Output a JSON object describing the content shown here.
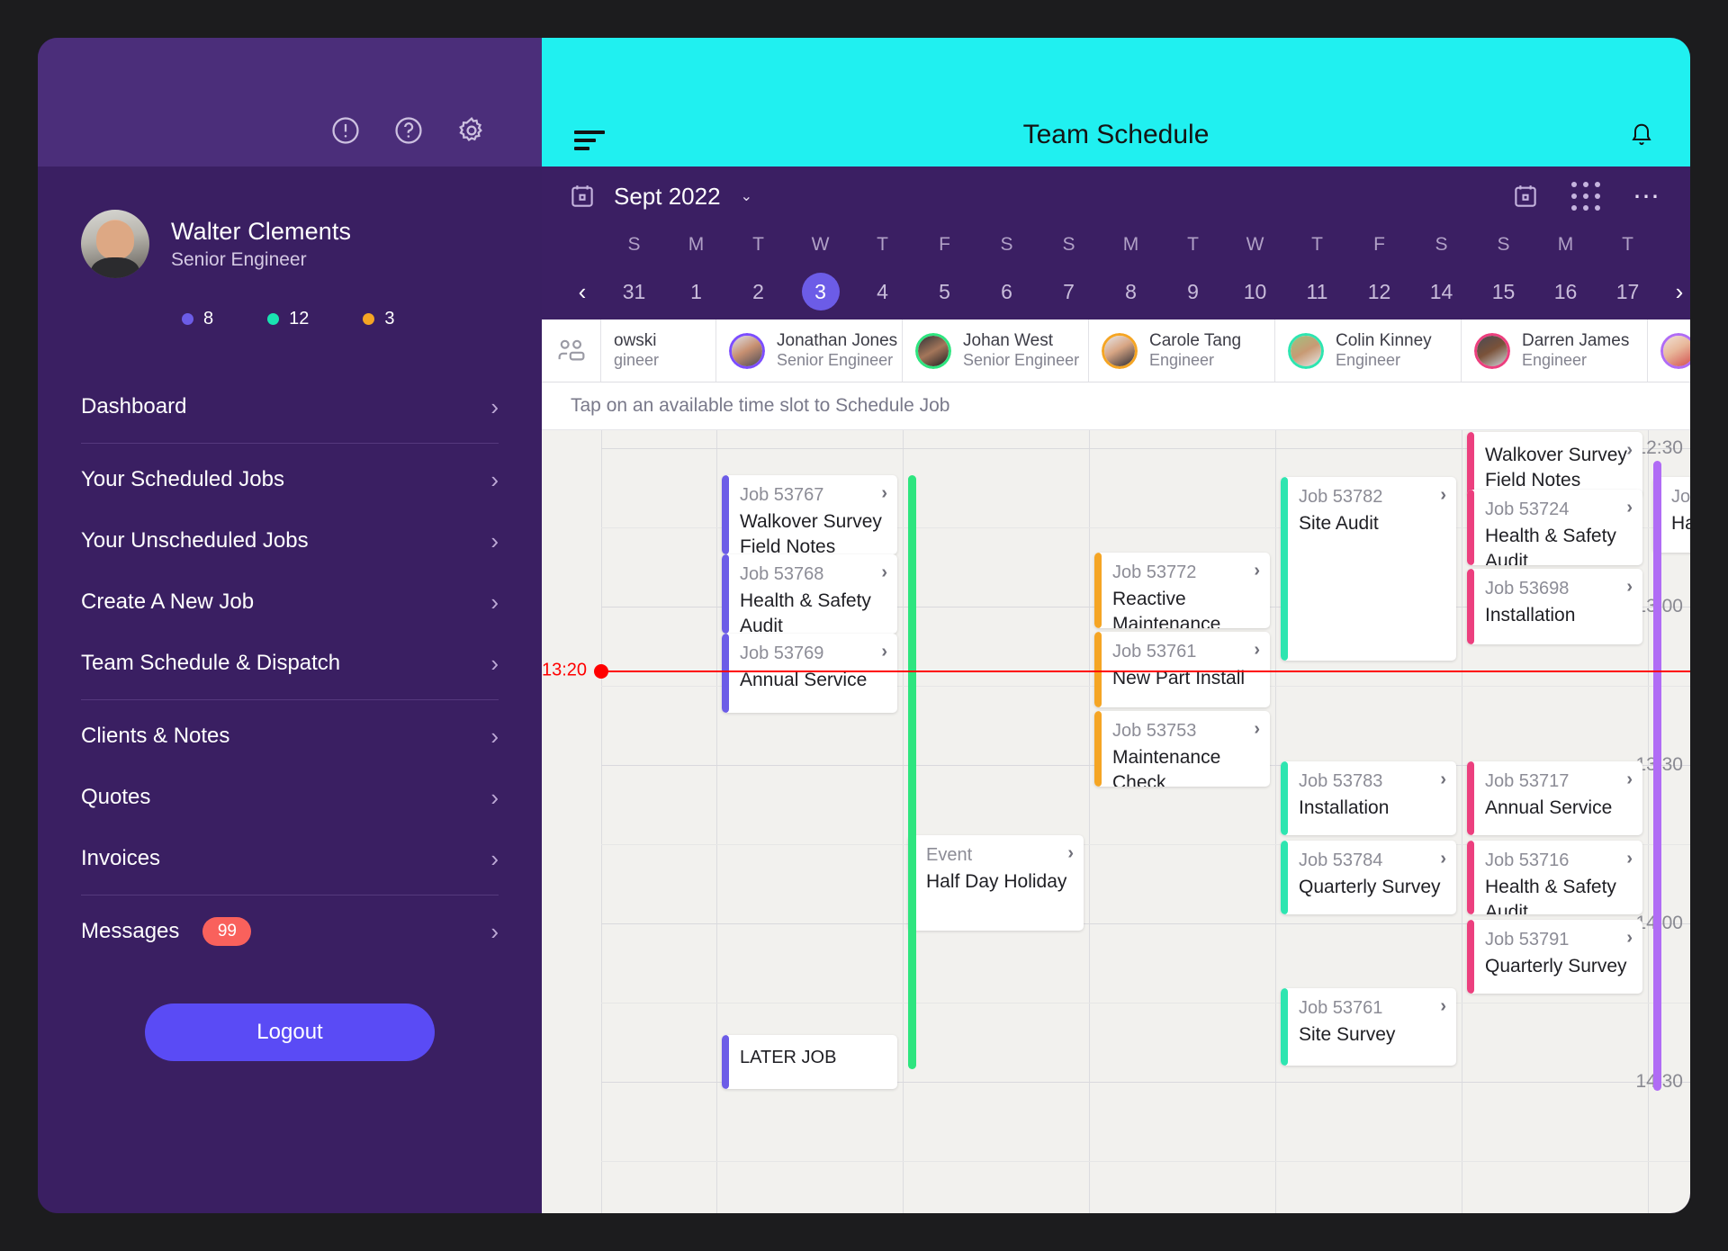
{
  "sidebar": {
    "top_icons": [
      {
        "name": "alert-icon",
        "label": "Alerts"
      },
      {
        "name": "help-icon",
        "label": "Help"
      },
      {
        "name": "gear-icon",
        "label": "Settings"
      }
    ],
    "profile": {
      "name": "Walter Clements",
      "role": "Senior Engineer"
    },
    "counters": [
      {
        "color": "#6c5ce7",
        "value": "8"
      },
      {
        "color": "#19e3b1",
        "value": "12"
      },
      {
        "color": "#f5a524",
        "value": "3"
      }
    ],
    "items": [
      {
        "label": "Dashboard",
        "sep_after": true
      },
      {
        "label": "Your Scheduled Jobs",
        "sep_after": false
      },
      {
        "label": "Your Unscheduled Jobs",
        "sep_after": false
      },
      {
        "label": "Create A New Job",
        "sep_after": false
      },
      {
        "label": "Team Schedule & Dispatch",
        "sep_after": true
      },
      {
        "label": "Clients & Notes",
        "sep_after": false
      },
      {
        "label": "Quotes",
        "sep_after": false
      },
      {
        "label": "Invoices",
        "sep_after": true
      }
    ],
    "messages": {
      "label": "Messages",
      "badge": "99"
    },
    "logout_label": "Logout"
  },
  "header": {
    "title": "Team Schedule",
    "menu_icon": "hamburger-icon",
    "bell_icon": "bell-icon",
    "accent": "#20F0F0"
  },
  "datebar": {
    "month": "Sept 2022",
    "caret": "⌄",
    "prev": "‹",
    "next": "›",
    "days": [
      {
        "dow": "S",
        "num": "31",
        "selected": false
      },
      {
        "dow": "M",
        "num": "1",
        "selected": false
      },
      {
        "dow": "T",
        "num": "2",
        "selected": false
      },
      {
        "dow": "W",
        "num": "3",
        "selected": true
      },
      {
        "dow": "T",
        "num": "4",
        "selected": false
      },
      {
        "dow": "F",
        "num": "5",
        "selected": false
      },
      {
        "dow": "S",
        "num": "6",
        "selected": false
      },
      {
        "dow": "S",
        "num": "7",
        "selected": false
      },
      {
        "dow": "M",
        "num": "8",
        "selected": false
      },
      {
        "dow": "T",
        "num": "9",
        "selected": false
      },
      {
        "dow": "W",
        "num": "10",
        "selected": false
      },
      {
        "dow": "T",
        "num": "11",
        "selected": false
      },
      {
        "dow": "F",
        "num": "12",
        "selected": false
      },
      {
        "dow": "S",
        "num": "14",
        "selected": false
      },
      {
        "dow": "S",
        "num": "15",
        "selected": false
      },
      {
        "dow": "M",
        "num": "16",
        "selected": false
      },
      {
        "dow": "T",
        "num": "17",
        "selected": false
      }
    ]
  },
  "engineers": [
    {
      "name": "owski",
      "role": "gineer",
      "ring": "#6c5ce7",
      "partial": true
    },
    {
      "name": "Jonathan Jones",
      "role": "Senior Engineer",
      "ring": "#7c4dff",
      "partial": false
    },
    {
      "name": "Johan West",
      "role": "Senior Engineer",
      "ring": "#2ee57f",
      "partial": false
    },
    {
      "name": "Carole Tang",
      "role": "Engineer",
      "ring": "#f5a524",
      "partial": false
    },
    {
      "name": "Colin Kinney",
      "role": "Engineer",
      "ring": "#2ee5b0",
      "partial": false
    },
    {
      "name": "Darren James",
      "role": "Engineer",
      "ring": "#ec3f7e",
      "partial": false
    },
    {
      "name": "",
      "role": "",
      "ring": "#b06cf5",
      "partial": true
    }
  ],
  "hint": "Tap on an available time slot to Schedule Job",
  "calendar": {
    "time_labels": [
      "12:30",
      "13:00",
      "13:30",
      "14:00",
      "14:30"
    ],
    "now": {
      "label": "13:20",
      "color": "#ff0000"
    },
    "jobs": [
      {
        "id": "Job 53767",
        "title": "Walkover Survey Field Notes",
        "color": "#6c5ce7",
        "col": 1,
        "arrow": true
      },
      {
        "id": "Job 53768",
        "title": "Health & Safety Audit",
        "color": "#6c5ce7",
        "col": 1,
        "arrow": true
      },
      {
        "id": "Job 53769",
        "title": "Annual Service",
        "color": "#6c5ce7",
        "col": 1,
        "arrow": true
      },
      {
        "id": "",
        "title": "LATER JOB",
        "color": "#6c5ce7",
        "col": 1,
        "arrow": false
      },
      {
        "id": "Event",
        "title": "Half Day Holiday",
        "color": "#2ee57f",
        "col": 2,
        "arrow": true
      },
      {
        "id": "Job 53772",
        "title": "Reactive Maintenance",
        "color": "#f5a524",
        "col": 3,
        "arrow": true
      },
      {
        "id": "Job 53761",
        "title": "New Part Install",
        "color": "#f5a524",
        "col": 3,
        "arrow": true
      },
      {
        "id": "Job 53753",
        "title": "Maintenance Check",
        "color": "#f5a524",
        "col": 3,
        "arrow": true
      },
      {
        "id": "Job 53782",
        "title": "Site Audit",
        "color": "#2ee5b0",
        "col": 4,
        "arrow": true
      },
      {
        "id": "Job 53783",
        "title": "Installation",
        "color": "#2ee5b0",
        "col": 4,
        "arrow": true
      },
      {
        "id": "Job 53784",
        "title": "Quarterly Survey",
        "color": "#2ee5b0",
        "col": 4,
        "arrow": true
      },
      {
        "id": "Job 53761",
        "title": "Site Survey",
        "color": "#2ee5b0",
        "col": 4,
        "arrow": true
      },
      {
        "id": "",
        "title": "Walkover Survey Field Notes",
        "color": "#ec3f7e",
        "col": 5,
        "arrow": true
      },
      {
        "id": "Job 53724",
        "title": "Health & Safety Audit",
        "color": "#ec3f7e",
        "col": 5,
        "arrow": true
      },
      {
        "id": "Job 53698",
        "title": "Installation",
        "color": "#ec3f7e",
        "col": 5,
        "arrow": true
      },
      {
        "id": "Job 53717",
        "title": "Annual Service",
        "color": "#ec3f7e",
        "col": 5,
        "arrow": true
      },
      {
        "id": "Job 53716",
        "title": "Health & Safety Audit",
        "color": "#ec3f7e",
        "col": 5,
        "arrow": true
      },
      {
        "id": "Job 53791",
        "title": "Quarterly Survey",
        "color": "#ec3f7e",
        "col": 5,
        "arrow": true
      },
      {
        "id": "Job",
        "title": "Hal",
        "color": "#b06cf5",
        "col": 6,
        "arrow": false
      }
    ]
  }
}
